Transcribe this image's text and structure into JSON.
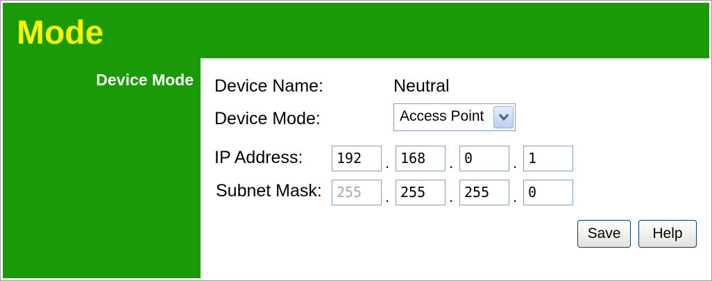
{
  "header": {
    "title": "Mode"
  },
  "sidebar": {
    "label": "Device Mode"
  },
  "form": {
    "device_name_label": "Device Name:",
    "device_name_value": "Neutral",
    "device_mode_label": "Device Mode:",
    "device_mode_value": "Access Point",
    "ip_label": "IP Address:",
    "ip": [
      "192",
      "168",
      "0",
      "1"
    ],
    "subnet_label": "Subnet Mask:",
    "subnet": [
      "255",
      "255",
      "255",
      "0"
    ],
    "dot": "."
  },
  "buttons": {
    "save": "Save",
    "help": "Help"
  },
  "colors": {
    "brand_green": "#1a9a06",
    "title_yellow": "#f7f700"
  }
}
